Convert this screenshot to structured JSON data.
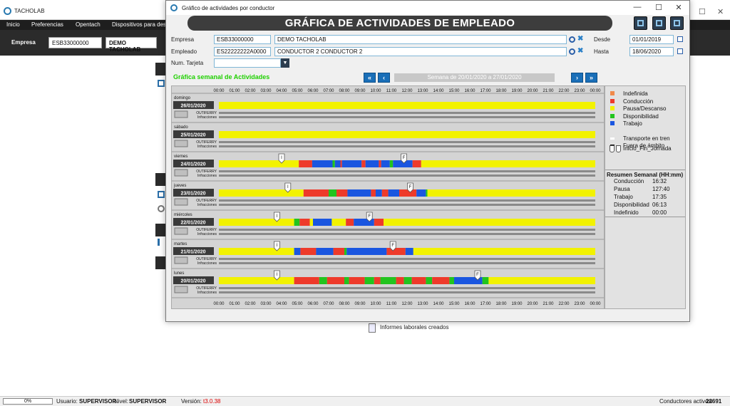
{
  "app": {
    "title": "TACHOLAB",
    "menu": [
      "Inicio",
      "Preferencias",
      "Opentach",
      "Dispositivos para des"
    ],
    "empresa_label": "Empresa",
    "empresa_code": "ESB33000000",
    "empresa_name": "DEMO TACHOLAB",
    "informes_label": "Informes laborales creados",
    "status": {
      "progress": "0%",
      "usuario_label": "Usuario:",
      "usuario": "SUPERVISOR",
      "nivel_label": "Nivel:",
      "nivel": "SUPERVISOR",
      "version_label": "Versión:",
      "version": "t3.0.38",
      "conductores_label": "Conductores activos:",
      "conductores": "23691"
    }
  },
  "dialog": {
    "title": "Gráfico de actividades por conductor",
    "window_controls": [
      "—",
      "☐",
      "✕"
    ],
    "banner": "GRÁFICA DE ACTIVIDADES DE EMPLEADO",
    "form": {
      "empresa_label": "Empresa",
      "empresa_code": "ESB33000000",
      "empresa_name": "DEMO TACHOLAB",
      "empleado_label": "Empleado",
      "empleado_code": "ES22222222A0000",
      "empleado_name": "CONDUCTOR 2 CONDUCTOR 2",
      "tarjeta_label": "Num. Tarjeta",
      "tarjeta_value": "",
      "desde_label": "Desde",
      "desde": "01/01/2019",
      "hasta_label": "Hasta",
      "hasta": "18/06/2020"
    },
    "graph_title": "Gráfica semanal de Actividades",
    "week_label": "Semana de 20/01/2020 a 27/01/2020",
    "nav": {
      "first": "«",
      "prev": "‹",
      "next": "›",
      "last": "»"
    }
  },
  "chart_data": {
    "type": "timeline",
    "hours": [
      "00:00",
      "01:00",
      "02:00",
      "03:00",
      "04:00",
      "05:00",
      "06:00",
      "07:00",
      "08:00",
      "09:00",
      "10:00",
      "11:00",
      "12:00",
      "13:00",
      "14:00",
      "15:00",
      "16:00",
      "17:00",
      "18:00",
      "19:00",
      "20:00",
      "21:00",
      "22:00",
      "23:00",
      "00:00"
    ],
    "colors": {
      "indefinida": "#f08a4b",
      "conduccion": "#ee3a2a",
      "pausa": "#f2f200",
      "disponibilidad": "#22c41e",
      "trabajo": "#1a56e0"
    },
    "row_sub": [
      "OUTIFERRY",
      "Infracciones"
    ],
    "days": [
      {
        "name": "domingo",
        "date": "26/01/2020",
        "segments": [
          [
            0,
            24,
            "pausa"
          ]
        ],
        "markers": []
      },
      {
        "name": "sábado",
        "date": "25/01/2020",
        "segments": [
          [
            0,
            24,
            "pausa"
          ]
        ],
        "markers": []
      },
      {
        "name": "viernes",
        "date": "24/01/2020",
        "segments": [
          [
            0,
            5.1,
            "pausa"
          ],
          [
            5.1,
            5.95,
            "conduccion"
          ],
          [
            5.95,
            7.25,
            "trabajo"
          ],
          [
            7.25,
            7.4,
            "disponibilidad"
          ],
          [
            7.4,
            7.75,
            "trabajo"
          ],
          [
            7.75,
            7.85,
            "conduccion"
          ],
          [
            7.85,
            9.1,
            "trabajo"
          ],
          [
            9.1,
            9.35,
            "conduccion"
          ],
          [
            9.35,
            10.2,
            "trabajo"
          ],
          [
            10.2,
            10.35,
            "conduccion"
          ],
          [
            10.35,
            10.9,
            "trabajo"
          ],
          [
            10.9,
            11.1,
            "disponibilidad"
          ],
          [
            11.1,
            12.35,
            "trabajo"
          ],
          [
            12.35,
            12.9,
            "conduccion"
          ],
          [
            12.9,
            24,
            "pausa"
          ]
        ],
        "markers": [
          [
            "I",
            4.0
          ],
          [
            "F",
            11.8
          ]
        ]
      },
      {
        "name": "jueves",
        "date": "23/01/2020",
        "segments": [
          [
            0,
            5.4,
            "pausa"
          ],
          [
            5.4,
            7.0,
            "conduccion"
          ],
          [
            7.0,
            7.5,
            "disponibilidad"
          ],
          [
            7.5,
            8.2,
            "conduccion"
          ],
          [
            8.2,
            9.7,
            "trabajo"
          ],
          [
            9.7,
            10.0,
            "conduccion"
          ],
          [
            10.0,
            10.4,
            "trabajo"
          ],
          [
            10.4,
            10.8,
            "conduccion"
          ],
          [
            10.8,
            11.5,
            "trabajo"
          ],
          [
            11.5,
            12.6,
            "conduccion"
          ],
          [
            12.6,
            13.2,
            "trabajo"
          ],
          [
            13.2,
            13.3,
            "disponibilidad"
          ],
          [
            13.3,
            24,
            "pausa"
          ]
        ],
        "markers": [
          [
            "I",
            4.4
          ],
          [
            "F",
            12.2
          ]
        ]
      },
      {
        "name": "miércoles",
        "date": "22/01/2020",
        "segments": [
          [
            0,
            4.8,
            "pausa"
          ],
          [
            4.8,
            5.15,
            "disponibilidad"
          ],
          [
            5.15,
            5.8,
            "conduccion"
          ],
          [
            5.8,
            6.0,
            "pausa"
          ],
          [
            6.0,
            7.2,
            "trabajo"
          ],
          [
            7.2,
            8.1,
            "pausa"
          ],
          [
            8.1,
            8.6,
            "conduccion"
          ],
          [
            8.6,
            9.9,
            "trabajo"
          ],
          [
            9.9,
            10.5,
            "conduccion"
          ],
          [
            10.5,
            24,
            "pausa"
          ]
        ],
        "markers": [
          [
            "I",
            3.7
          ],
          [
            "F",
            9.6
          ]
        ]
      },
      {
        "name": "martes",
        "date": "21/01/2020",
        "segments": [
          [
            0,
            4.8,
            "pausa"
          ],
          [
            4.8,
            5.2,
            "trabajo"
          ],
          [
            5.2,
            6.2,
            "conduccion"
          ],
          [
            6.2,
            7.3,
            "trabajo"
          ],
          [
            7.3,
            8.0,
            "conduccion"
          ],
          [
            8.0,
            8.15,
            "disponibilidad"
          ],
          [
            8.15,
            10.7,
            "trabajo"
          ],
          [
            10.7,
            11.9,
            "conduccion"
          ],
          [
            11.9,
            12.4,
            "trabajo"
          ],
          [
            12.4,
            24,
            "pausa"
          ]
        ],
        "markers": [
          [
            "I",
            3.7
          ],
          [
            "F",
            11.1
          ]
        ]
      },
      {
        "name": "lunes",
        "date": "20/01/2020",
        "segments": [
          [
            0,
            4.8,
            "pausa"
          ],
          [
            4.8,
            6.4,
            "conduccion"
          ],
          [
            6.4,
            6.9,
            "disponibilidad"
          ],
          [
            6.9,
            8.0,
            "conduccion"
          ],
          [
            8.0,
            8.3,
            "disponibilidad"
          ],
          [
            8.3,
            9.3,
            "conduccion"
          ],
          [
            9.3,
            9.9,
            "disponibilidad"
          ],
          [
            9.9,
            10.3,
            "conduccion"
          ],
          [
            10.3,
            11.3,
            "disponibilidad"
          ],
          [
            11.3,
            11.8,
            "conduccion"
          ],
          [
            11.8,
            12.3,
            "disponibilidad"
          ],
          [
            12.3,
            13.2,
            "conduccion"
          ],
          [
            13.2,
            13.6,
            "disponibilidad"
          ],
          [
            13.6,
            14.7,
            "conduccion"
          ],
          [
            14.7,
            15.0,
            "disponibilidad"
          ],
          [
            15.0,
            16.8,
            "trabajo"
          ],
          [
            16.8,
            17.2,
            "disponibilidad"
          ],
          [
            17.2,
            24,
            "pausa"
          ]
        ],
        "markers": [
          [
            "I",
            3.7
          ],
          [
            "F",
            16.5
          ]
        ]
      }
    ]
  },
  "legend": {
    "items": [
      {
        "label": "Indefinida",
        "color": "#f08a4b"
      },
      {
        "label": "Conducción",
        "color": "#ee3a2a"
      },
      {
        "label": "Pausa/Descanso",
        "color": "#f2f200"
      },
      {
        "label": "Disponibilidad",
        "color": "#22c41e"
      },
      {
        "label": "Trabajo",
        "color": "#1a56e0"
      },
      {
        "label": "Transporte en tren",
        "color": "#ffffff"
      },
      {
        "label": "Fuera de ámbito",
        "color": "#000000"
      }
    ],
    "marker_label": "Inicio_Fin_Jornada",
    "summary_title": "Resumen Semanal (HH:mm)",
    "summary": [
      {
        "label": "Conducción",
        "value": "16:32"
      },
      {
        "label": "Pausa",
        "value": "127:40"
      },
      {
        "label": "Trabajo",
        "value": "17:35"
      },
      {
        "label": "Disponibilidad",
        "value": "06:13"
      },
      {
        "label": "Indefinido",
        "value": "00:00"
      }
    ]
  }
}
